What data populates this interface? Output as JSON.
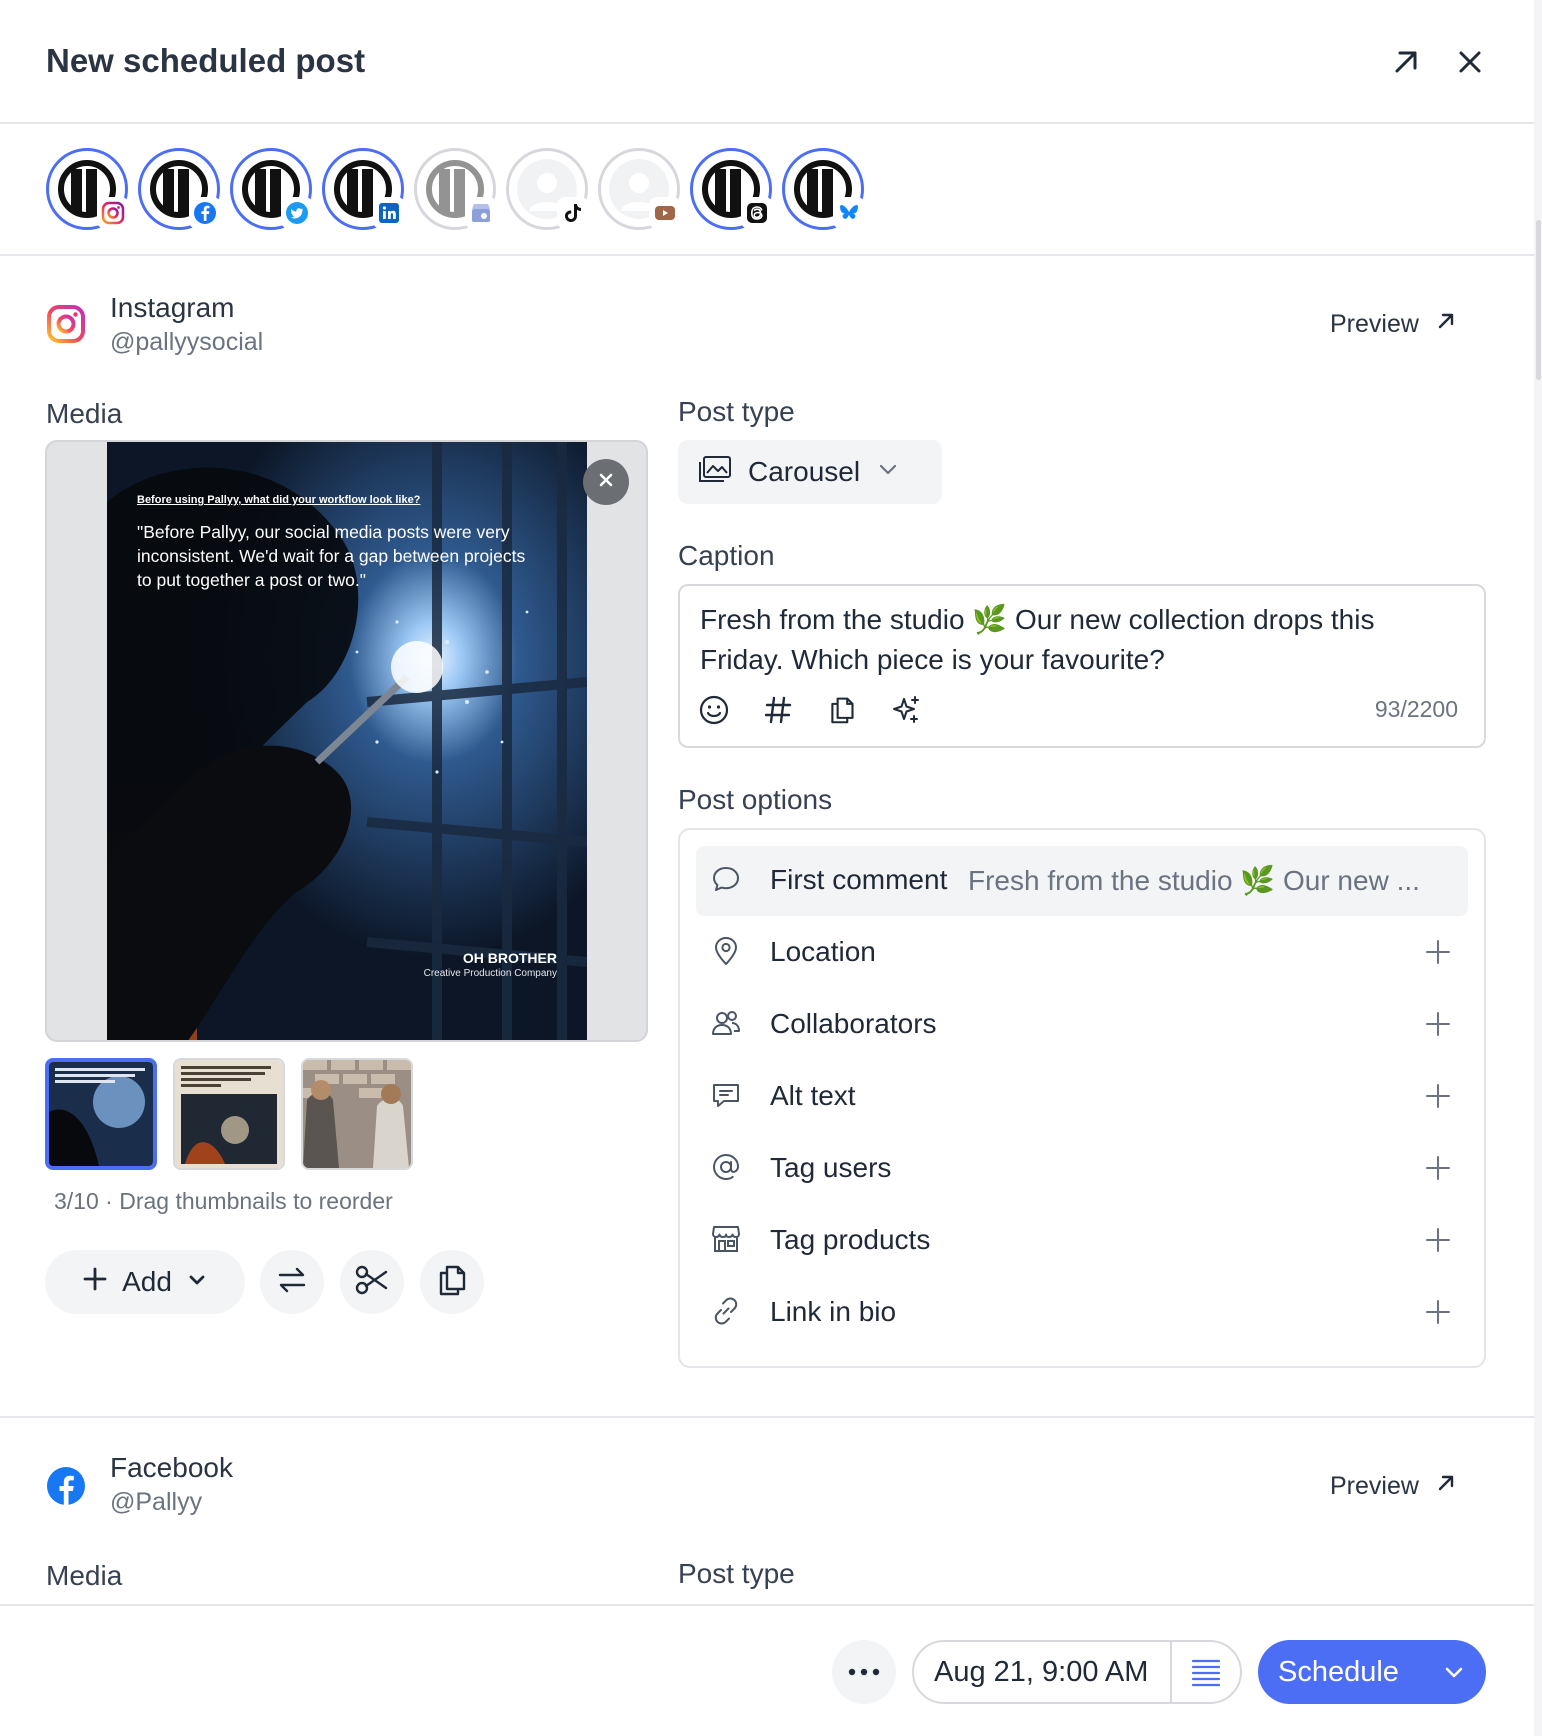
{
  "header": {
    "title": "New scheduled post",
    "expand_icon": "arrow-up-right-icon",
    "close_icon": "close-icon"
  },
  "accounts": [
    {
      "network": "instagram",
      "active": true
    },
    {
      "network": "facebook",
      "active": true
    },
    {
      "network": "twitter",
      "active": true
    },
    {
      "network": "linkedin",
      "active": true
    },
    {
      "network": "google-business",
      "active": false
    },
    {
      "network": "tiktok",
      "active": false
    },
    {
      "network": "youtube",
      "active": false
    },
    {
      "network": "threads",
      "active": true
    },
    {
      "network": "bluesky",
      "active": true
    }
  ],
  "instagram": {
    "name": "Instagram",
    "handle": "@pallyysocial",
    "preview_label": "Preview",
    "media_label": "Media",
    "media_image": {
      "question": "Before using Pallyy, what did your workflow look like?",
      "quote": "\"Before Pallyy, our social media posts were very inconsistent. We'd wait for a gap between projects to put together a post or two.\"",
      "brand": "OH BROTHER",
      "brand_sub": "Creative Production Company"
    },
    "reorder_text": "3/10 · Drag thumbnails to reorder",
    "add_label": "Add",
    "post_type_label": "Post type",
    "post_type_value": "Carousel",
    "caption_label": "Caption",
    "caption_text": "Fresh from the studio 🌿  Our new collection drops this Friday. Which piece is your favourite?",
    "caption_counter": "93/2200",
    "post_options_label": "Post options",
    "options": [
      {
        "label": "First comment",
        "value": "Fresh from the studio 🌿  Our new ...",
        "icon": "comment-icon"
      },
      {
        "label": "Location",
        "icon": "location-pin-icon"
      },
      {
        "label": "Collaborators",
        "icon": "users-icon"
      },
      {
        "label": "Alt text",
        "icon": "alt-text-icon"
      },
      {
        "label": "Tag users",
        "icon": "at-sign-icon"
      },
      {
        "label": "Tag products",
        "icon": "store-icon"
      },
      {
        "label": "Link in bio",
        "icon": "link-icon"
      }
    ]
  },
  "facebook": {
    "name": "Facebook",
    "handle": "@Pallyy",
    "preview_label": "Preview",
    "media_label": "Media",
    "post_type_label": "Post type"
  },
  "footer": {
    "date_value": "Aug 21, 9:00 AM",
    "schedule_label": "Schedule"
  },
  "colors": {
    "accent": "#4c6ef5",
    "text": "#1f2937",
    "muted": "#6b7280",
    "border": "#d7d9dd"
  }
}
